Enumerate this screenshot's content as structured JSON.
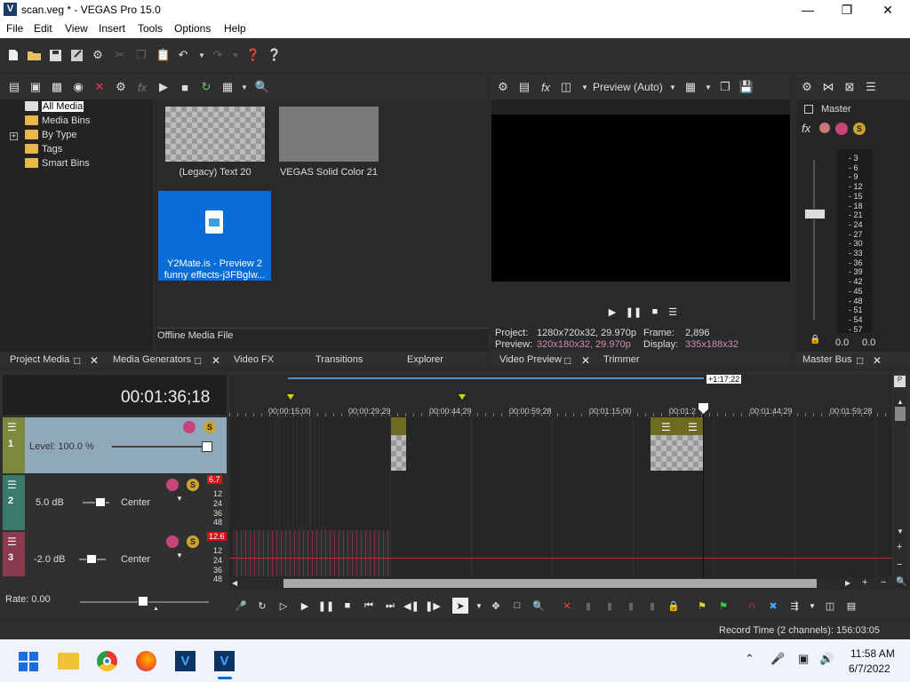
{
  "window": {
    "title": "scan.veg * - VEGAS Pro 15.0"
  },
  "menu": [
    "File",
    "Edit",
    "View",
    "Insert",
    "Tools",
    "Options",
    "Help"
  ],
  "media": {
    "tree": [
      "All Media",
      "Media Bins",
      "By Type",
      "Tags",
      "Smart Bins"
    ],
    "items": [
      {
        "label": "(Legacy) Text 20"
      },
      {
        "label": "VEGAS Solid Color 21"
      },
      {
        "label1": "Y2Mate.is - Preview 2",
        "label2": "funny effects-j3FBglw..."
      }
    ],
    "status": "Offline Media File",
    "tabs": [
      "Project Media",
      "Media Generators",
      "Video FX",
      "Transitions",
      "Explorer"
    ]
  },
  "preview": {
    "mode": "Preview (Auto)",
    "project_label": "Project:",
    "project_value": "1280x720x32, 29.970p",
    "preview_label": "Preview:",
    "preview_value": "320x180x32, 29.970p",
    "frame_label": "Frame:",
    "frame_value": "2,896",
    "display_label": "Display:",
    "display_value": "335x188x32",
    "tabs": [
      "Video Preview",
      "Trimmer"
    ]
  },
  "master": {
    "title": "Master",
    "scale": [
      "3",
      "6",
      "9",
      "12",
      "15",
      "18",
      "21",
      "24",
      "27",
      "30",
      "33",
      "36",
      "39",
      "42",
      "45",
      "48",
      "51",
      "54",
      "57"
    ],
    "left_value": "0.0",
    "right_value": "0.0",
    "tab": "Master Bus"
  },
  "timeline": {
    "timecode": "00:01:36;18",
    "region_length": "+1:17;22",
    "ruler": [
      "00:00:15:00",
      "00:00:29:29",
      "00:00:44:29",
      "00:00:59:28",
      "00:01:15:00",
      "00:01:2",
      "00:01:44:29",
      "00:01:59:28"
    ],
    "tracks": [
      {
        "num": "1",
        "level": "Level: 100.0 %"
      },
      {
        "num": "2",
        "volume": "5.0 dB",
        "pan": "Center",
        "peak": "6.7",
        "scale": [
          "12",
          "24",
          "36",
          "48"
        ]
      },
      {
        "num": "3",
        "volume": "-2.0 dB",
        "pan": "Center",
        "peak": "12.6",
        "scale": [
          "12",
          "24",
          "36",
          "48"
        ]
      }
    ],
    "rate": "Rate: 0.00"
  },
  "statusbar": {
    "record_time": "Record Time (2 channels): 156:03:05"
  },
  "taskbar": {
    "time": "11:58 AM",
    "date": "6/7/2022"
  },
  "colors": {
    "accent_blue": "#0a6cd6",
    "track1": "#7d8a3d",
    "track2": "#3a7a6a",
    "track3": "#8a3a4f",
    "peak_red": "#d4131a"
  }
}
